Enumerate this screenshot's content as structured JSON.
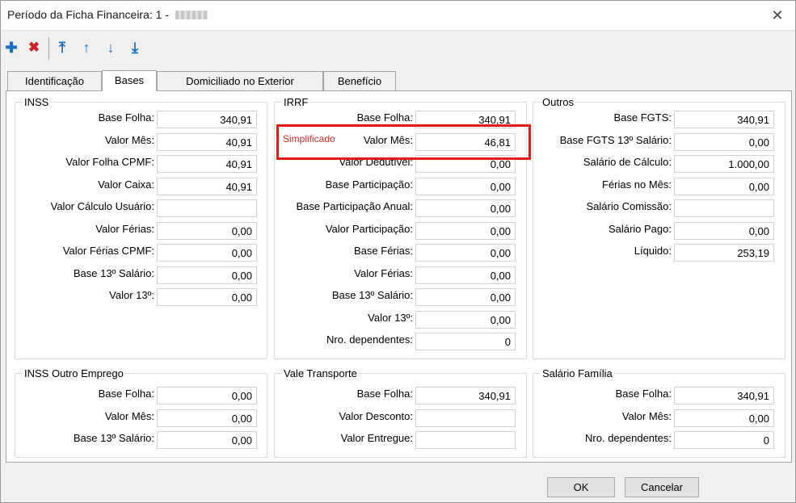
{
  "window": {
    "title": "Período da Ficha Financeira: 1 - ",
    "close_icon": "✕"
  },
  "toolbar": {
    "add_icon": "✚",
    "delete_icon": "✖",
    "first_icon": "⤒",
    "up_icon": "↑",
    "down_icon": "↓",
    "last_icon": "⤓",
    "colors": {
      "add": "#1a6fc4",
      "delete": "#d0202a",
      "nav": "#1a6fc4"
    }
  },
  "tabs": [
    "Identificação",
    "Bases",
    "Domiciliado no Exterior",
    "Benefício"
  ],
  "active_tab": "Bases",
  "inss": {
    "title": "INSS",
    "rows": [
      {
        "label": "Base Folha:",
        "value": "340,91"
      },
      {
        "label": "Valor Mês:",
        "value": "40,91"
      },
      {
        "label": "Valor Folha CPMF:",
        "value": "40,91"
      },
      {
        "label": "Valor Caixa:",
        "value": "40,91"
      },
      {
        "label": "Valor Cálculo Usuário:",
        "value": ""
      },
      {
        "label": "Valor Férias:",
        "value": "0,00"
      },
      {
        "label": "Valor Férias CPMF:",
        "value": "0,00"
      },
      {
        "label": "Base 13º Salário:",
        "value": "0,00"
      },
      {
        "label": "Valor 13º:",
        "value": "0,00"
      }
    ]
  },
  "irrf": {
    "title": "IRRF",
    "annotation": "Simplificado",
    "rows": [
      {
        "label": "Base Folha:",
        "value": "340,91"
      },
      {
        "label": "Valor Mês:",
        "value": "46,81"
      },
      {
        "label": "Valor Dedutível:",
        "value": "0,00"
      },
      {
        "label": "Base Participação:",
        "value": "0,00"
      },
      {
        "label": "Base Participação Anual:",
        "value": "0,00"
      },
      {
        "label": "Valor Participação:",
        "value": "0,00"
      },
      {
        "label": "Base Férias:",
        "value": "0,00"
      },
      {
        "label": "Valor Férias:",
        "value": "0,00"
      },
      {
        "label": "Base 13º Salário:",
        "value": "0,00"
      },
      {
        "label": "Valor 13º:",
        "value": "0,00"
      },
      {
        "label": "Nro. dependentes:",
        "value": "0"
      }
    ]
  },
  "outros": {
    "title": "Outros",
    "rows": [
      {
        "label": "Base FGTS:",
        "value": "340,91"
      },
      {
        "label": "Base FGTS 13º Salário:",
        "value": "0,00"
      },
      {
        "label": "Salário de Cálculo:",
        "value": "1.000,00"
      },
      {
        "label": "Férias no Mês:",
        "value": "0,00"
      },
      {
        "label": "Salário Comissão:",
        "value": ""
      },
      {
        "label": "Salário Pago:",
        "value": "0,00"
      },
      {
        "label": "Líquido:",
        "value": "253,19"
      }
    ]
  },
  "inss_outro": {
    "title": "INSS Outro Emprego",
    "rows": [
      {
        "label": "Base Folha:",
        "value": "0,00"
      },
      {
        "label": "Valor Mês:",
        "value": "0,00"
      },
      {
        "label": "Base 13º Salário:",
        "value": "0,00"
      }
    ]
  },
  "vale": {
    "title": "Vale Transporte",
    "rows": [
      {
        "label": "Base Folha:",
        "value": "340,91"
      },
      {
        "label": "Valor Desconto:",
        "value": ""
      },
      {
        "label": "Valor Entregue:",
        "value": ""
      }
    ]
  },
  "familia": {
    "title": "Salário Família",
    "rows": [
      {
        "label": "Base Folha:",
        "value": "340,91"
      },
      {
        "label": "Valor Mês:",
        "value": "0,00"
      },
      {
        "label": "Nro. dependentes:",
        "value": "0"
      }
    ]
  },
  "buttons": {
    "ok": "OK",
    "cancel": "Cancelar"
  }
}
